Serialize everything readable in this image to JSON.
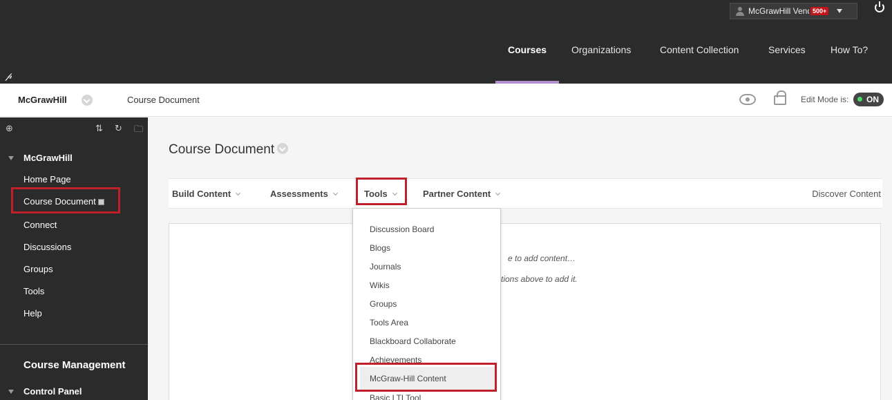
{
  "header": {
    "username": "McGrawHill Vendor",
    "notification_badge": "500+",
    "nav": {
      "courses": "Courses",
      "organizations": "Organizations",
      "content_collection": "Content Collection",
      "services": "Services",
      "how_to": "How To?"
    },
    "accent_underline": "#b08ed0"
  },
  "breadcrumb": {
    "course": "McGrawHill",
    "page": "Course Document",
    "edit_mode_label": "Edit Mode is:",
    "edit_mode_state": "ON"
  },
  "sidebar": {
    "course_title": "McGrawHill",
    "items": [
      {
        "label": "Home Page"
      },
      {
        "label": "Course Document"
      },
      {
        "label": "Connect"
      },
      {
        "label": "Discussions"
      },
      {
        "label": "Groups"
      },
      {
        "label": "Tools"
      },
      {
        "label": "Help"
      }
    ],
    "course_management": "Course Management",
    "control_panel": "Control Panel"
  },
  "content": {
    "title": "Course Document",
    "actions": {
      "build_content": "Build Content",
      "assessments": "Assessments",
      "tools": "Tools",
      "partner_content": "Partner Content",
      "discover_content": "Discover Content"
    },
    "empty_line1": "e to add content…",
    "empty_line2": "tions above to add it."
  },
  "tools_menu": {
    "items": [
      "Discussion Board",
      "Blogs",
      "Journals",
      "Wikis",
      "Groups",
      "Tools Area",
      "Blackboard Collaborate",
      "Achievements",
      "McGraw-Hill Content",
      "Basic LTI Tool"
    ]
  },
  "colors": {
    "highlight_border": "#c0202a",
    "toggle_dot": "#4cd964",
    "badge": "#c3151c"
  }
}
